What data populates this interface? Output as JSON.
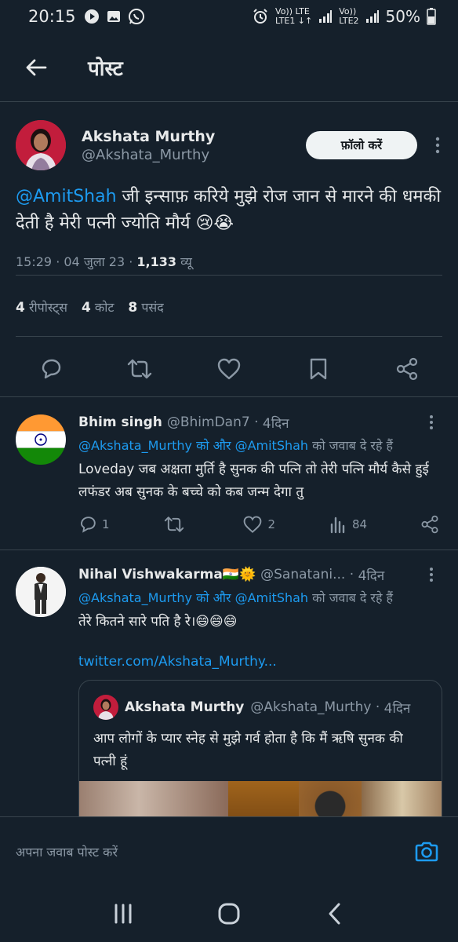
{
  "status_bar": {
    "time": "20:15",
    "sim1_label": "Vo)) LTE\nLTE1",
    "sim1_top": "Vo)) LTE",
    "sim1_bottom": "LTE1 ↓↑",
    "sim2_top": "Vo))",
    "sim2_bottom": "LTE2",
    "battery": "50%"
  },
  "header": {
    "title": "पोस्ट"
  },
  "post": {
    "author_name": "Akshata Murthy",
    "author_handle": "@Akshata_Murthy",
    "follow_label": "फ़ॉलो करें",
    "mention": "@AmitShah",
    "text": " जी इन्साफ़ करिये मुझे रोज जान से मारने की धमकी देती है मेरी पत्नी ज्योति मौर्य 😢😭",
    "time": "15:29",
    "date": "04 जुला 23",
    "views_count": "1,133",
    "views_label": "व्यू",
    "reposts_count": "4",
    "reposts_label": "रीपोस्ट्स",
    "quotes_count": "4",
    "quotes_label": "कोट",
    "likes_count": "8",
    "likes_label": "पसंद"
  },
  "replies": [
    {
      "name": "Bhim singh",
      "handle": "@BhimDan7",
      "age": "4दिन",
      "replying_to": "@Akshata_Murthy को और @AmitShah",
      "replying_suffix": "को जवाब दे रहे हैं",
      "text": "Loveday जब अक्षता मुर्ति है सुनक की पत्नि तो तेरी पत्नि मौर्य कैसे हुई लफंडर अब सुनक के बच्चे को कब जन्म देगा तु",
      "replies": "1",
      "reposts": "",
      "likes": "2",
      "views": "84"
    },
    {
      "name": "Nihal Vishwakarma🇮🇳🌞",
      "handle": "@Sanatani...",
      "age": "4दिन",
      "replying_to": "@Akshata_Murthy को और @AmitShah",
      "replying_suffix": "को जवाब दे रहे हैं",
      "text": "तेरे कितने सारे पति है रे।😄😄😄",
      "link": "twitter.com/Akshata_Murthy...",
      "quote": {
        "name": "Akshata Murthy",
        "handle": "@Akshata_Murthy",
        "age": "4दिन",
        "text": "आप लोगों के प्यार स्नेह से मुझे गर्व होता है कि मैं ऋषि सुनक की पत्नी हूं"
      }
    }
  ],
  "reply_bar": {
    "placeholder": "अपना जवाब पोस्ट करें"
  },
  "colors": {
    "background": "#15202b",
    "accent": "#1d9bf0",
    "muted": "#8b98a5",
    "border": "#38444d"
  }
}
